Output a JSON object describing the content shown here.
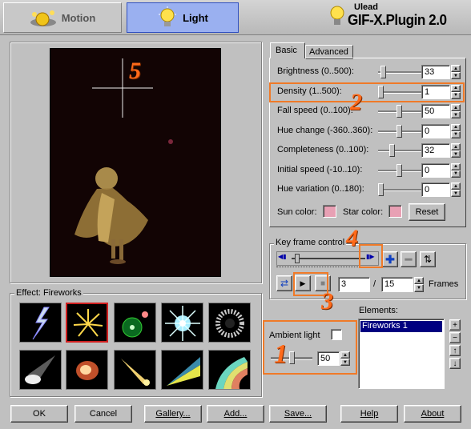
{
  "header": {
    "tab_motion": "Motion",
    "tab_light": "Light",
    "brand_small": "Ulead",
    "brand_big": "GIF-X.Plugin 2.0"
  },
  "preview": {
    "marker": "5"
  },
  "effect": {
    "title": "Effect: Fireworks",
    "icons": [
      "lightning-icon",
      "fireworks-icon",
      "green-orb-icon",
      "starburst-icon",
      "ring-icon",
      "spotlight-icon",
      "glow-icon",
      "comet-icon",
      "beam-icon",
      "rainbow-icon"
    ]
  },
  "tabs": {
    "basic": "Basic",
    "advanced": "Advanced"
  },
  "params": [
    {
      "label": "Brightness (0..500):",
      "value": "33",
      "level": 0.07
    },
    {
      "label": "Density (1..500):",
      "value": "1",
      "level": 0.0
    },
    {
      "label": "Fall speed (0..100):",
      "value": "50",
      "level": 0.5
    },
    {
      "label": "Hue change (-360..360):",
      "value": "0",
      "level": 0.5
    },
    {
      "label": "Completeness (0..100):",
      "value": "32",
      "level": 0.32
    },
    {
      "label": "Initial speed (-10..10):",
      "value": "0",
      "level": 0.5
    },
    {
      "label": "Hue variation (0..180):",
      "value": "0",
      "level": 0.0
    }
  ],
  "colors": {
    "sun_label": "Sun color:",
    "star_label": "Star color:",
    "reset_label": "Reset",
    "sun_color": "#e8a0b4",
    "star_color": "#e8a0b4"
  },
  "keyframe": {
    "title": "Key frame control",
    "current_frame": "3",
    "slash": "/",
    "total_frames": "15",
    "frames_label": "Frames"
  },
  "elements": {
    "title": "Elements:",
    "items": [
      "Fireworks 1"
    ]
  },
  "ambient": {
    "label": "Ambient light",
    "value": "50",
    "level": 0.5
  },
  "annotations": {
    "n1": "1",
    "n2": "2",
    "n3": "3",
    "n4": "4"
  },
  "footer": {
    "ok": "OK",
    "cancel": "Cancel",
    "gallery": "Gallery...",
    "add": "Add...",
    "save": "Save...",
    "help": "Help",
    "about": "About"
  }
}
